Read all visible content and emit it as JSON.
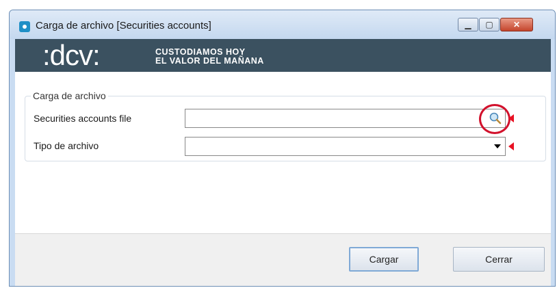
{
  "window": {
    "title": "Carga de archivo [Securities accounts]",
    "controls": {
      "minimize": "▁",
      "maximize": "▢",
      "close": "✕"
    }
  },
  "banner": {
    "logo_text": ":dcv:",
    "slogan_line1": "CUSTODIAMOS HOY",
    "slogan_line2": "EL VALOR DEL MAÑANA"
  },
  "form": {
    "group_title": "Carga de archivo",
    "file_label": "Securities accounts file",
    "file_value": "",
    "type_label": "Tipo de archivo",
    "type_value": ""
  },
  "buttons": {
    "load": "Cargar",
    "close": "Cerrar"
  },
  "colors": {
    "banner": "#3b5160",
    "required_marker": "#e81123",
    "callout": "#d2112c"
  },
  "icons": {
    "search": "magnifier-icon"
  }
}
